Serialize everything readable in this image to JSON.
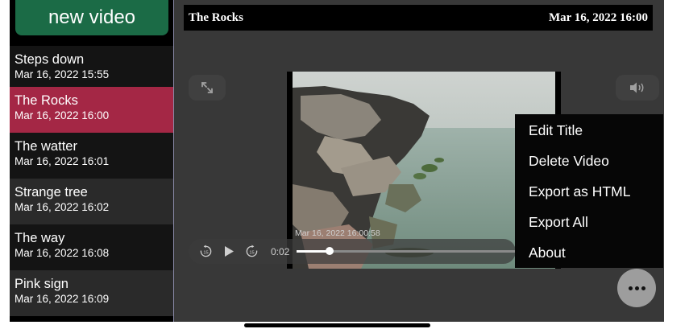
{
  "sidebar": {
    "new_video_label": "new video",
    "items": [
      {
        "title": "Steps down",
        "date": "Mar 16, 2022 15:55"
      },
      {
        "title": "The Rocks",
        "date": "Mar 16, 2022 16:00"
      },
      {
        "title": "The watter",
        "date": "Mar 16, 2022 16:01"
      },
      {
        "title": "Strange tree",
        "date": "Mar 16, 2022 16:02"
      },
      {
        "title": "The way",
        "date": "Mar 16, 2022 16:08"
      },
      {
        "title": "Pink sign",
        "date": "Mar 16, 2022 16:09"
      }
    ],
    "selected_color": "#a42745",
    "button_color": "#1b6b46"
  },
  "header": {
    "title": "The Rocks",
    "date": "Mar 16, 2022 16:00"
  },
  "video": {
    "timestamp_overlay": "Mar 16, 2022 16:00:58",
    "current_time": "0:02",
    "progress_fraction": 0.15
  },
  "menu": {
    "items": [
      "Edit Title",
      "Delete Video",
      "Export as HTML",
      "Export All",
      "About"
    ]
  },
  "icons": {
    "expand": "expand-icon",
    "volume": "speaker-icon",
    "skip_back": "skip-back-15-icon",
    "play": "play-icon",
    "skip_forward": "skip-forward-15-icon",
    "more": "ellipsis-icon"
  }
}
